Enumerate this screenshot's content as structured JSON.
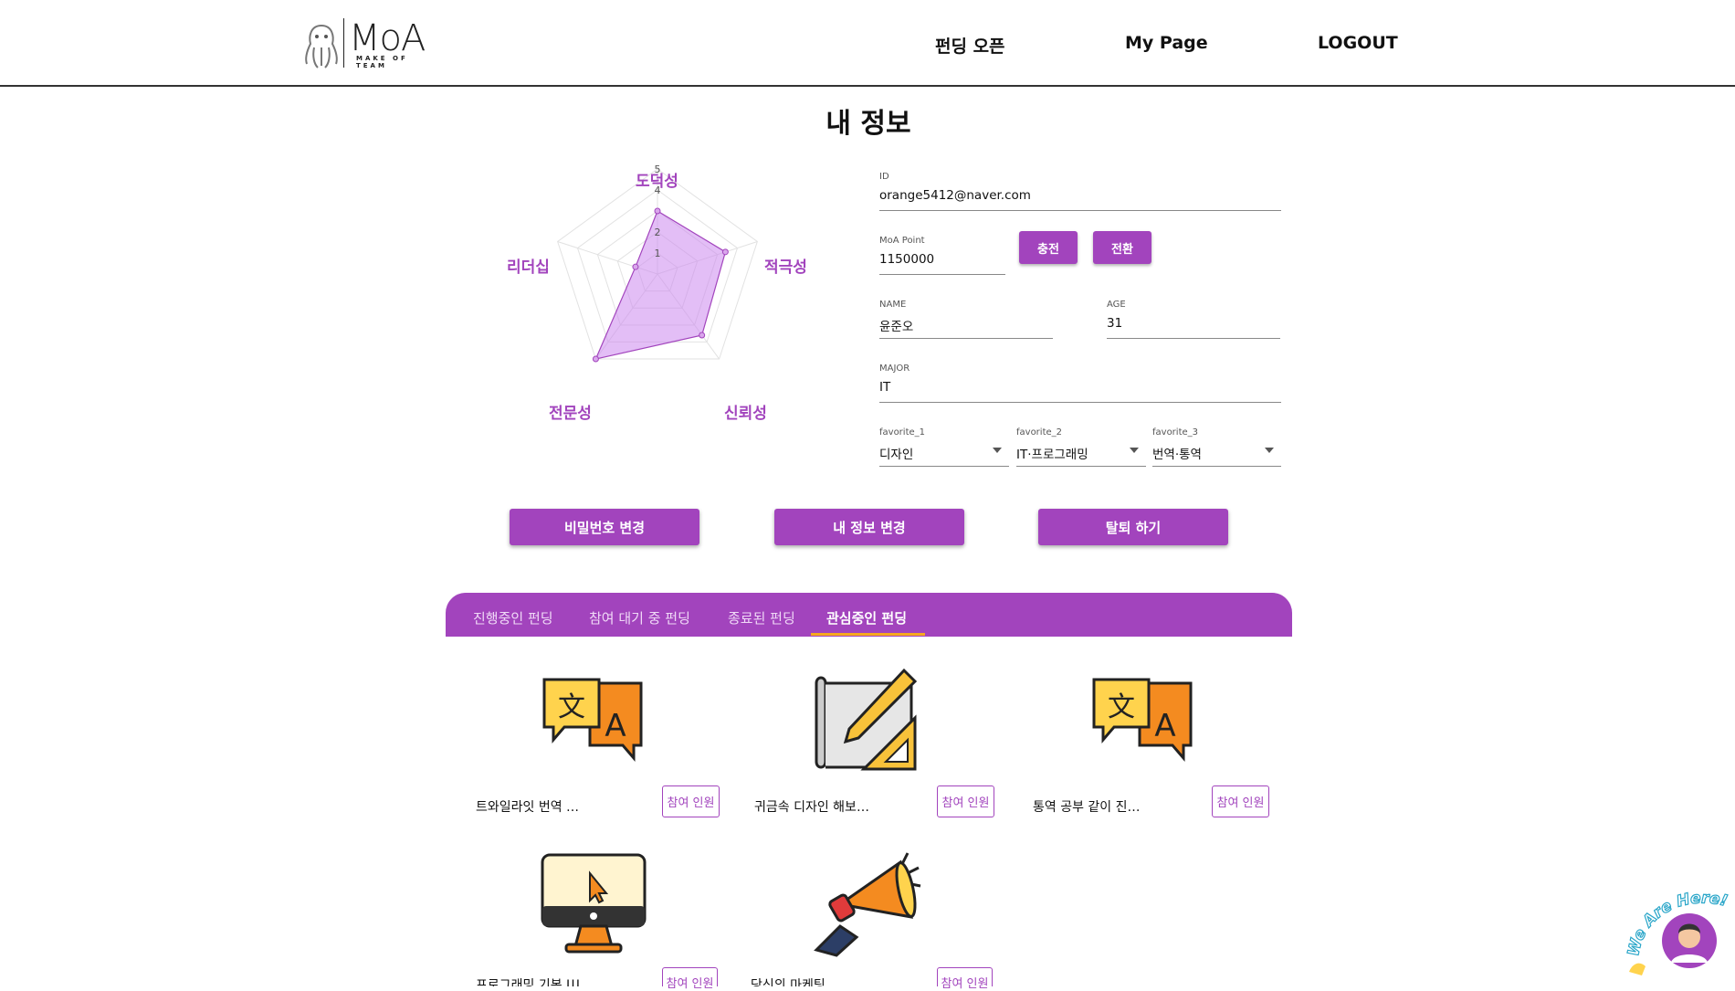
{
  "header": {
    "logo_text": "MoA",
    "logo_sub": "MAKE OF TEAM",
    "nav": [
      "펀딩 오픈",
      "My Page",
      "LOGOUT"
    ]
  },
  "page": {
    "title": "내 정보"
  },
  "radar": {
    "labels": [
      "도덕성",
      "적극성",
      "신뢰성",
      "전문성",
      "리더십"
    ],
    "ticks": [
      "5",
      "4",
      "2",
      "1"
    ],
    "values": [
      3.0,
      3.4,
      3.6,
      5.0,
      1.1
    ],
    "max": 5,
    "fill_color": "#cc88ee",
    "stroke_color": "#a244bd"
  },
  "profile": {
    "id": {
      "label": "ID",
      "value": "orange5412@naver.com"
    },
    "point": {
      "label": "MoA Point",
      "value": "1150000",
      "charge_label": "충전",
      "convert_label": "전환"
    },
    "name": {
      "label": "NAME",
      "value": "윤준오"
    },
    "age": {
      "label": "AGE",
      "value": "31"
    },
    "major": {
      "label": "MAJOR",
      "value": "IT"
    },
    "favorites": [
      {
        "label": "favorite_1",
        "value": "디자인"
      },
      {
        "label": "favorite_2",
        "value": "IT·프로그래밍"
      },
      {
        "label": "favorite_3",
        "value": "번역·통역"
      }
    ]
  },
  "actions": {
    "change_password": "비밀번호 변경",
    "edit_info": "내 정보 변경",
    "withdraw": "탈퇴 하기"
  },
  "tabs": [
    "진행중인 펀딩",
    "참여 대기 중 펀딩",
    "종료된 펀딩",
    "관심중인 펀딩"
  ],
  "cards": [
    {
      "title": "트와일라잇 번역 …",
      "button": "참여 인원",
      "icon": "translate-icon"
    },
    {
      "title": "귀금속 디자인 해보…",
      "button": "참여 인원",
      "icon": "design-icon"
    },
    {
      "title": "통역 공부 같이 진…",
      "button": "참여 인원",
      "icon": "translate-icon"
    },
    {
      "title": "프로그래밍 기본 Ш…",
      "button": "참여 인원",
      "icon": "computer-icon"
    },
    {
      "title": "당신의 마케팅 …",
      "button": "참여 인원",
      "icon": "megaphone-icon"
    }
  ],
  "chat": {
    "text": "We Are Here!"
  },
  "colors": {
    "accent": "#a244bd",
    "tab_underline": "#f6a81f"
  }
}
